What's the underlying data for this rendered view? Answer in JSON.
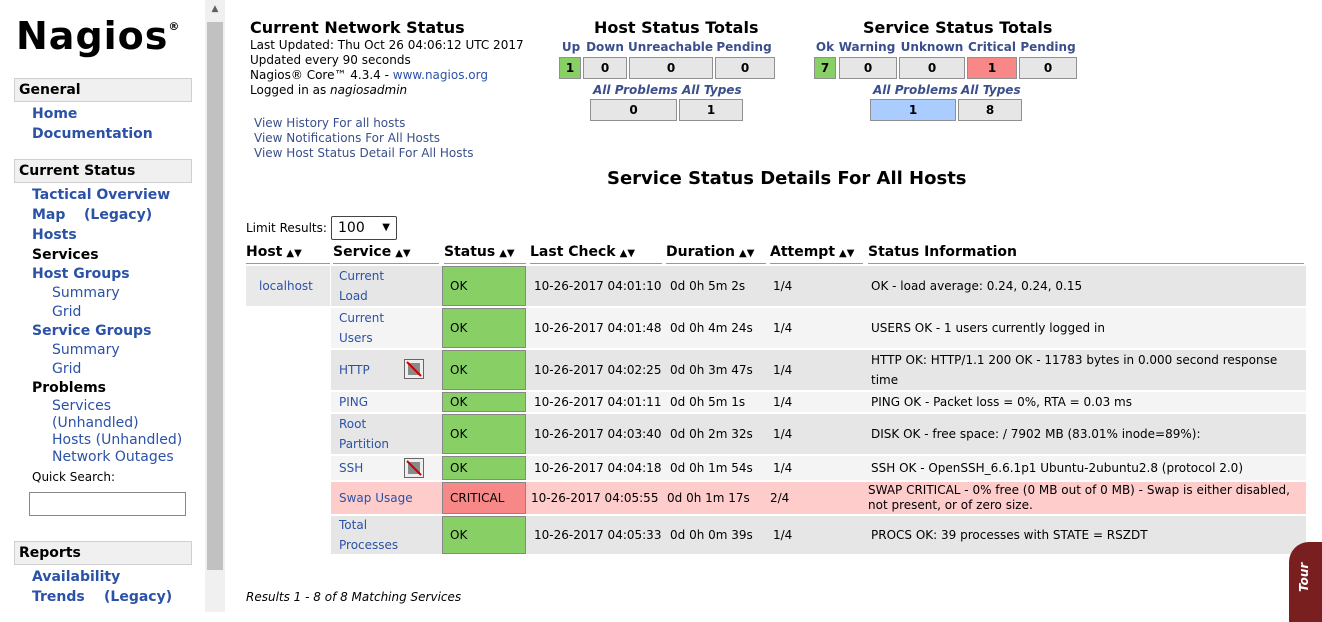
{
  "logo": "Nagios",
  "nav": {
    "general": "General",
    "home": "Home",
    "documentation": "Documentation",
    "current_status": "Current Status",
    "tactical_overview": "Tactical Overview",
    "map": "Map",
    "map_legacy": "(Legacy)",
    "hosts": "Hosts",
    "services": "Services",
    "host_groups": "Host Groups",
    "hg_summary": "Summary",
    "hg_grid": "Grid",
    "service_groups": "Service Groups",
    "sg_summary": "Summary",
    "sg_grid": "Grid",
    "problems": "Problems",
    "p_services": "Services",
    "p_unhandled": "(Unhandled)",
    "p_hosts": "Hosts (Unhandled)",
    "p_outages": "Network Outages",
    "quick_search": "Quick Search:",
    "reports": "Reports",
    "availability": "Availability",
    "trends": "Trends",
    "trends_legacy": "(Legacy)"
  },
  "status": {
    "title": "Current Network Status",
    "last_updated": "Last Updated: Thu Oct 26 04:06:12 UTC 2017",
    "updated_every": "Updated every 90 seconds",
    "core_prefix": "Nagios® Core™ 4.3.4 - ",
    "core_link": "www.nagios.org",
    "logged_prefix": "Logged in as ",
    "logged_user": "nagiosadmin",
    "link_history": "View History For all hosts",
    "link_notifications": "View Notifications For All Hosts",
    "link_detail": "View Host Status Detail For All Hosts"
  },
  "host_totals": {
    "title": "Host Status Totals",
    "labels": [
      "Up",
      "Down",
      "Unreachable",
      "Pending"
    ],
    "values": [
      "1",
      "0",
      "0",
      "0"
    ],
    "all_problems": "All Problems",
    "all_types": "All Types",
    "problems_value": "0",
    "types_value": "1"
  },
  "service_totals": {
    "title": "Service Status Totals",
    "labels": [
      "Ok",
      "Warning",
      "Unknown",
      "Critical",
      "Pending"
    ],
    "values": [
      "7",
      "0",
      "0",
      "1",
      "0"
    ],
    "all_problems": "All Problems",
    "all_types": "All Types",
    "problems_value": "1",
    "types_value": "8"
  },
  "details_title": "Service Status Details For All Hosts",
  "limit": {
    "label": "Limit Results:",
    "value": "100"
  },
  "columns": [
    "Host",
    "Service",
    "Status",
    "Last Check",
    "Duration",
    "Attempt",
    "Status Information"
  ],
  "host": "localhost",
  "rows": [
    {
      "service1": "Current",
      "service2": "Load",
      "status": "OK",
      "last_check": "10-26-2017 04:01:10",
      "duration": "0d 0h 5m 2s",
      "attempt": "1/4",
      "info": "OK - load average: 0.24, 0.24, 0.15"
    },
    {
      "service1": "Current",
      "service2": "Users",
      "status": "OK",
      "last_check": "10-26-2017 04:01:48",
      "duration": "0d 0h 4m 24s",
      "attempt": "1/4",
      "info": "USERS OK - 1 users currently logged in"
    },
    {
      "service1": "HTTP",
      "service2": "",
      "status": "OK",
      "last_check": "10-26-2017 04:02:25",
      "duration": "0d 0h 3m 47s",
      "attempt": "1/4",
      "info": "HTTP OK: HTTP/1.1 200 OK - 11783 bytes in 0.000 second response time"
    },
    {
      "service1": "PING",
      "service2": "",
      "status": "OK",
      "last_check": "10-26-2017 04:01:11",
      "duration": "0d 0h 5m 1s",
      "attempt": "1/4",
      "info": "PING OK - Packet loss = 0%, RTA = 0.03 ms"
    },
    {
      "service1": "Root",
      "service2": "Partition",
      "status": "OK",
      "last_check": "10-26-2017 04:03:40",
      "duration": "0d 0h 2m 32s",
      "attempt": "1/4",
      "info": "DISK OK - free space: / 7902 MB (83.01% inode=89%):"
    },
    {
      "service1": "SSH",
      "service2": "",
      "status": "OK",
      "last_check": "10-26-2017 04:04:18",
      "duration": "0d 0h 1m 54s",
      "attempt": "1/4",
      "info": "SSH OK - OpenSSH_6.6.1p1 Ubuntu-2ubuntu2.8 (protocol 2.0)"
    },
    {
      "service1": "Swap Usage",
      "service2": "",
      "status": "CRITICAL",
      "last_check": "10-26-2017 04:05:55",
      "duration": "0d 0h 1m 17s",
      "attempt": "2/4",
      "info": "SWAP CRITICAL - 0% free (0 MB out of 0 MB) - Swap is either disabled, not present, or of zero size."
    },
    {
      "service1": "Total",
      "service2": "Processes",
      "status": "OK",
      "last_check": "10-26-2017 04:05:33",
      "duration": "0d 0h 0m 39s",
      "attempt": "1/4",
      "info": "PROCS OK: 39 processes with STATE = RSZDT"
    }
  ],
  "results": "Results 1 - 8 of 8 Matching Services",
  "tour": "Tour",
  "colors": {
    "ok": "#88d066",
    "critical": "#f88888",
    "link": "#2b52a6"
  }
}
